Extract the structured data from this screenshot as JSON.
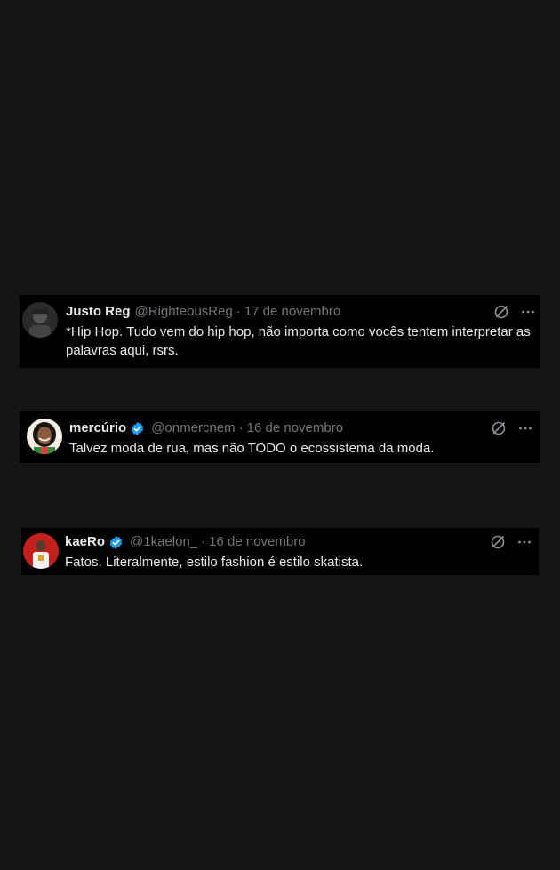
{
  "colors": {
    "page_background": "#141414",
    "card_background": "#000000",
    "name_text": "#e7e9ea",
    "muted_text": "#71767b",
    "verified_blue": "#1d9bf0"
  },
  "tweets": [
    {
      "name": "Justo Reg",
      "verified": false,
      "handle": "@RighteousReg",
      "date": "17 de novembro",
      "text": "*Hip Hop. Tudo vem do hip hop, não importa como vocês tentem interpretar as palavras aqui, rsrs.",
      "icons": [
        "grok-icon",
        "more-icon"
      ]
    },
    {
      "name": "mercúrio",
      "verified": true,
      "handle": "@onmercnem",
      "date": "16 de novembro",
      "text": "Talvez moda de rua, mas não TODO o ecossistema da moda.",
      "icons": [
        "verified-badge-icon",
        "grok-icon",
        "more-icon"
      ]
    },
    {
      "name": "kaeRo",
      "verified": true,
      "handle": "@1kaelon_",
      "date": "16 de novembro",
      "text": "Fatos. Literalmente, estilo fashion é estilo skatista.",
      "icons": [
        "verified-badge-icon",
        "grok-icon",
        "more-icon"
      ]
    }
  ],
  "separator": "·"
}
